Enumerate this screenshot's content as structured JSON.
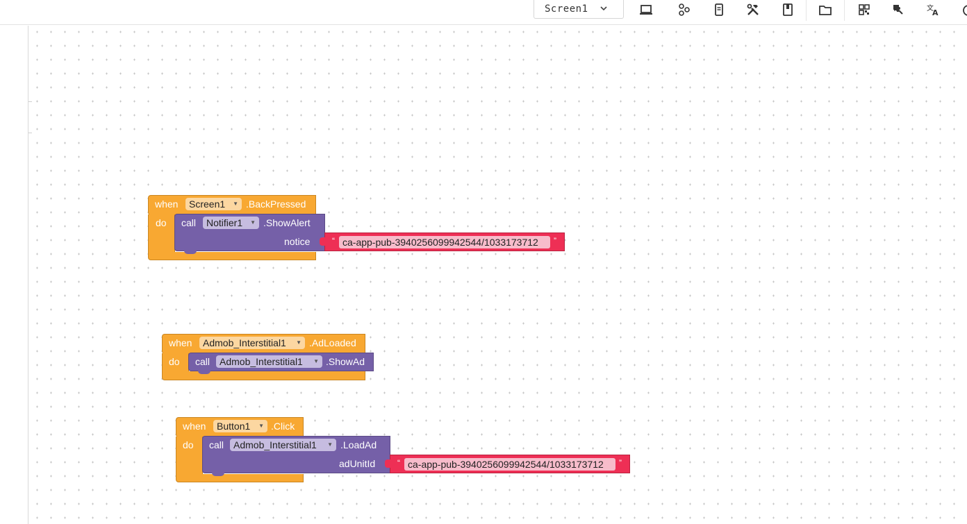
{
  "toolbar": {
    "screen_select": {
      "value": "Screen1",
      "icon": "chevron-down-icon"
    },
    "icons": [
      "laptop-icon",
      "components-tree-icon",
      "phone-preview-icon",
      "build-tools-icon",
      "book-icon",
      "folder-icon",
      "dashboard-grid-icon",
      "extension-icon",
      "translate-icon",
      "timer-icon"
    ]
  },
  "colors": {
    "event_block": "#f8a832",
    "procedure_block": "#7560a8",
    "text_block": "#ee2f55"
  },
  "blocks": [
    {
      "when": "when",
      "component": "Screen1",
      "event": ".BackPressed",
      "do": "do",
      "call": "call",
      "call_component": "Notifier1",
      "method": ".ShowAlert",
      "param_label": "notice",
      "quote_open": "“",
      "param_value": "ca-app-pub-3940256099942544/1033173712",
      "quote_close": "”"
    },
    {
      "when": "when",
      "component": "Admob_Interstitial1",
      "event": ".AdLoaded",
      "do": "do",
      "call": "call",
      "call_component": "Admob_Interstitial1",
      "method": ".ShowAd"
    },
    {
      "when": "when",
      "component": "Button1",
      "event": ".Click",
      "do": "do",
      "call": "call",
      "call_component": "Admob_Interstitial1",
      "method": ".LoadAd",
      "param_label": "adUnitId",
      "quote_open": "“",
      "param_value": "ca-app-pub-3940256099942544/1033173712",
      "quote_close": "”"
    }
  ]
}
